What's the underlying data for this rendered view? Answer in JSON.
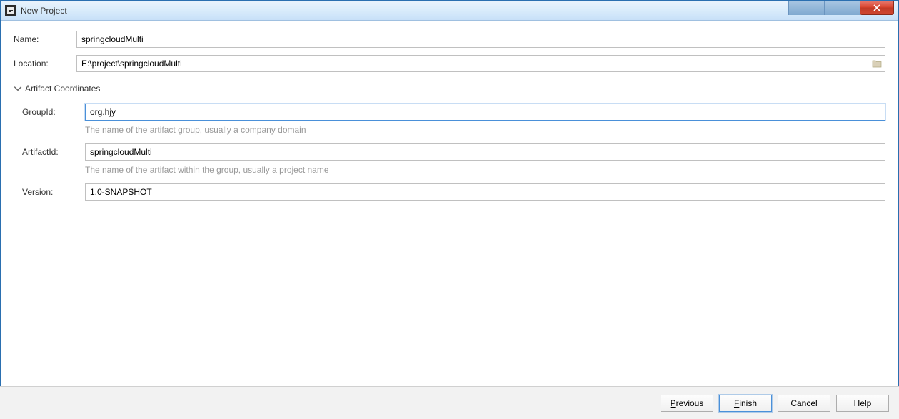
{
  "titlebar": {
    "title": "New Project"
  },
  "form": {
    "name_label": "Name:",
    "name_value": "springcloudMulti",
    "location_label": "Location:",
    "location_value": "E:\\project\\springcloudMulti"
  },
  "section": {
    "title": "Artifact Coordinates",
    "groupid_label": "GroupId:",
    "groupid_value": "org.hjy",
    "groupid_hint": "The name of the artifact group, usually a company domain",
    "artifactid_label": "ArtifactId:",
    "artifactid_value": "springcloudMulti",
    "artifactid_hint": "The name of the artifact within the group, usually a project name",
    "version_label": "Version:",
    "version_value": "1.0-SNAPSHOT"
  },
  "footer": {
    "previous_label": "Previous",
    "finish_label": "Finish",
    "cancel_label": "Cancel",
    "help_label": "Help"
  }
}
